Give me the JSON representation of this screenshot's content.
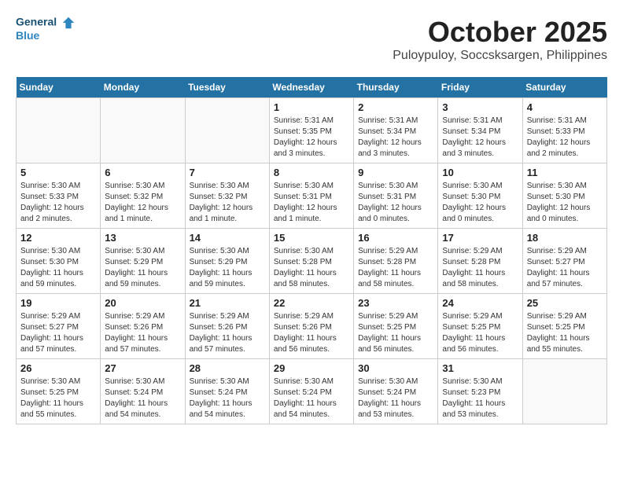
{
  "logo": {
    "line1": "General",
    "line2": "Blue",
    "tagline": ""
  },
  "title": "October 2025",
  "location": "Puloypuloy, Soccsksargen, Philippines",
  "weekdays": [
    "Sunday",
    "Monday",
    "Tuesday",
    "Wednesday",
    "Thursday",
    "Friday",
    "Saturday"
  ],
  "weeks": [
    [
      {
        "day": "",
        "sunrise": "",
        "sunset": "",
        "daylight": ""
      },
      {
        "day": "",
        "sunrise": "",
        "sunset": "",
        "daylight": ""
      },
      {
        "day": "",
        "sunrise": "",
        "sunset": "",
        "daylight": ""
      },
      {
        "day": "1",
        "sunrise": "Sunrise: 5:31 AM",
        "sunset": "Sunset: 5:35 PM",
        "daylight": "Daylight: 12 hours and 3 minutes."
      },
      {
        "day": "2",
        "sunrise": "Sunrise: 5:31 AM",
        "sunset": "Sunset: 5:34 PM",
        "daylight": "Daylight: 12 hours and 3 minutes."
      },
      {
        "day": "3",
        "sunrise": "Sunrise: 5:31 AM",
        "sunset": "Sunset: 5:34 PM",
        "daylight": "Daylight: 12 hours and 3 minutes."
      },
      {
        "day": "4",
        "sunrise": "Sunrise: 5:31 AM",
        "sunset": "Sunset: 5:33 PM",
        "daylight": "Daylight: 12 hours and 2 minutes."
      }
    ],
    [
      {
        "day": "5",
        "sunrise": "Sunrise: 5:30 AM",
        "sunset": "Sunset: 5:33 PM",
        "daylight": "Daylight: 12 hours and 2 minutes."
      },
      {
        "day": "6",
        "sunrise": "Sunrise: 5:30 AM",
        "sunset": "Sunset: 5:32 PM",
        "daylight": "Daylight: 12 hours and 1 minute."
      },
      {
        "day": "7",
        "sunrise": "Sunrise: 5:30 AM",
        "sunset": "Sunset: 5:32 PM",
        "daylight": "Daylight: 12 hours and 1 minute."
      },
      {
        "day": "8",
        "sunrise": "Sunrise: 5:30 AM",
        "sunset": "Sunset: 5:31 PM",
        "daylight": "Daylight: 12 hours and 1 minute."
      },
      {
        "day": "9",
        "sunrise": "Sunrise: 5:30 AM",
        "sunset": "Sunset: 5:31 PM",
        "daylight": "Daylight: 12 hours and 0 minutes."
      },
      {
        "day": "10",
        "sunrise": "Sunrise: 5:30 AM",
        "sunset": "Sunset: 5:30 PM",
        "daylight": "Daylight: 12 hours and 0 minutes."
      },
      {
        "day": "11",
        "sunrise": "Sunrise: 5:30 AM",
        "sunset": "Sunset: 5:30 PM",
        "daylight": "Daylight: 12 hours and 0 minutes."
      }
    ],
    [
      {
        "day": "12",
        "sunrise": "Sunrise: 5:30 AM",
        "sunset": "Sunset: 5:30 PM",
        "daylight": "Daylight: 11 hours and 59 minutes."
      },
      {
        "day": "13",
        "sunrise": "Sunrise: 5:30 AM",
        "sunset": "Sunset: 5:29 PM",
        "daylight": "Daylight: 11 hours and 59 minutes."
      },
      {
        "day": "14",
        "sunrise": "Sunrise: 5:30 AM",
        "sunset": "Sunset: 5:29 PM",
        "daylight": "Daylight: 11 hours and 59 minutes."
      },
      {
        "day": "15",
        "sunrise": "Sunrise: 5:30 AM",
        "sunset": "Sunset: 5:28 PM",
        "daylight": "Daylight: 11 hours and 58 minutes."
      },
      {
        "day": "16",
        "sunrise": "Sunrise: 5:29 AM",
        "sunset": "Sunset: 5:28 PM",
        "daylight": "Daylight: 11 hours and 58 minutes."
      },
      {
        "day": "17",
        "sunrise": "Sunrise: 5:29 AM",
        "sunset": "Sunset: 5:28 PM",
        "daylight": "Daylight: 11 hours and 58 minutes."
      },
      {
        "day": "18",
        "sunrise": "Sunrise: 5:29 AM",
        "sunset": "Sunset: 5:27 PM",
        "daylight": "Daylight: 11 hours and 57 minutes."
      }
    ],
    [
      {
        "day": "19",
        "sunrise": "Sunrise: 5:29 AM",
        "sunset": "Sunset: 5:27 PM",
        "daylight": "Daylight: 11 hours and 57 minutes."
      },
      {
        "day": "20",
        "sunrise": "Sunrise: 5:29 AM",
        "sunset": "Sunset: 5:26 PM",
        "daylight": "Daylight: 11 hours and 57 minutes."
      },
      {
        "day": "21",
        "sunrise": "Sunrise: 5:29 AM",
        "sunset": "Sunset: 5:26 PM",
        "daylight": "Daylight: 11 hours and 57 minutes."
      },
      {
        "day": "22",
        "sunrise": "Sunrise: 5:29 AM",
        "sunset": "Sunset: 5:26 PM",
        "daylight": "Daylight: 11 hours and 56 minutes."
      },
      {
        "day": "23",
        "sunrise": "Sunrise: 5:29 AM",
        "sunset": "Sunset: 5:25 PM",
        "daylight": "Daylight: 11 hours and 56 minutes."
      },
      {
        "day": "24",
        "sunrise": "Sunrise: 5:29 AM",
        "sunset": "Sunset: 5:25 PM",
        "daylight": "Daylight: 11 hours and 56 minutes."
      },
      {
        "day": "25",
        "sunrise": "Sunrise: 5:29 AM",
        "sunset": "Sunset: 5:25 PM",
        "daylight": "Daylight: 11 hours and 55 minutes."
      }
    ],
    [
      {
        "day": "26",
        "sunrise": "Sunrise: 5:30 AM",
        "sunset": "Sunset: 5:25 PM",
        "daylight": "Daylight: 11 hours and 55 minutes."
      },
      {
        "day": "27",
        "sunrise": "Sunrise: 5:30 AM",
        "sunset": "Sunset: 5:24 PM",
        "daylight": "Daylight: 11 hours and 54 minutes."
      },
      {
        "day": "28",
        "sunrise": "Sunrise: 5:30 AM",
        "sunset": "Sunset: 5:24 PM",
        "daylight": "Daylight: 11 hours and 54 minutes."
      },
      {
        "day": "29",
        "sunrise": "Sunrise: 5:30 AM",
        "sunset": "Sunset: 5:24 PM",
        "daylight": "Daylight: 11 hours and 54 minutes."
      },
      {
        "day": "30",
        "sunrise": "Sunrise: 5:30 AM",
        "sunset": "Sunset: 5:24 PM",
        "daylight": "Daylight: 11 hours and 53 minutes."
      },
      {
        "day": "31",
        "sunrise": "Sunrise: 5:30 AM",
        "sunset": "Sunset: 5:23 PM",
        "daylight": "Daylight: 11 hours and 53 minutes."
      },
      {
        "day": "",
        "sunrise": "",
        "sunset": "",
        "daylight": ""
      }
    ]
  ]
}
